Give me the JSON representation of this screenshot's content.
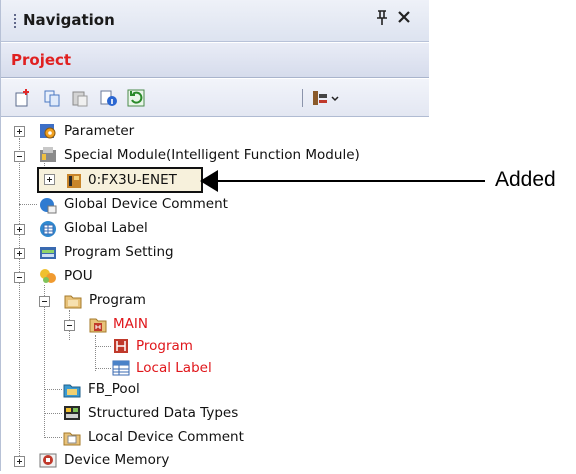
{
  "panel": {
    "title": "Navigation",
    "pin_glyph": "ᵖ",
    "close_glyph": "×"
  },
  "header": {
    "title": "Project"
  },
  "toolbar": {
    "icons": [
      "new-item-icon",
      "copy-icon",
      "paste-icon",
      "properties-icon",
      "refresh-icon",
      "settings-dropdown-icon"
    ]
  },
  "tree": {
    "items": [
      {
        "label": "Parameter",
        "icon": "parameter-icon"
      },
      {
        "label": "Special Module(Intelligent Function Module)",
        "icon": "special-module-icon"
      },
      {
        "label": "0:FX3U-ENET",
        "icon": "module-icon"
      },
      {
        "label": "Global Device Comment",
        "icon": "device-comment-icon"
      },
      {
        "label": "Global Label",
        "icon": "global-label-icon"
      },
      {
        "label": "Program Setting",
        "icon": "program-setting-icon"
      },
      {
        "label": "POU",
        "icon": "pou-icon"
      },
      {
        "label": "Program",
        "icon": "program-folder-icon"
      },
      {
        "label": "MAIN",
        "icon": "main-program-icon"
      },
      {
        "label": "Program",
        "icon": "program-body-icon"
      },
      {
        "label": "Local Label",
        "icon": "local-label-icon"
      },
      {
        "label": "FB_Pool",
        "icon": "fb-pool-icon"
      },
      {
        "label": "Structured Data Types",
        "icon": "structured-data-icon"
      },
      {
        "label": "Local Device Comment",
        "icon": "local-comment-icon"
      },
      {
        "label": "Device Memory",
        "icon": "device-memory-icon"
      }
    ]
  },
  "callout": {
    "text": "Added"
  },
  "colors": {
    "header_title": "#e02020",
    "red_label": "#e0161b",
    "selection_fill": "#f7f1dc"
  }
}
